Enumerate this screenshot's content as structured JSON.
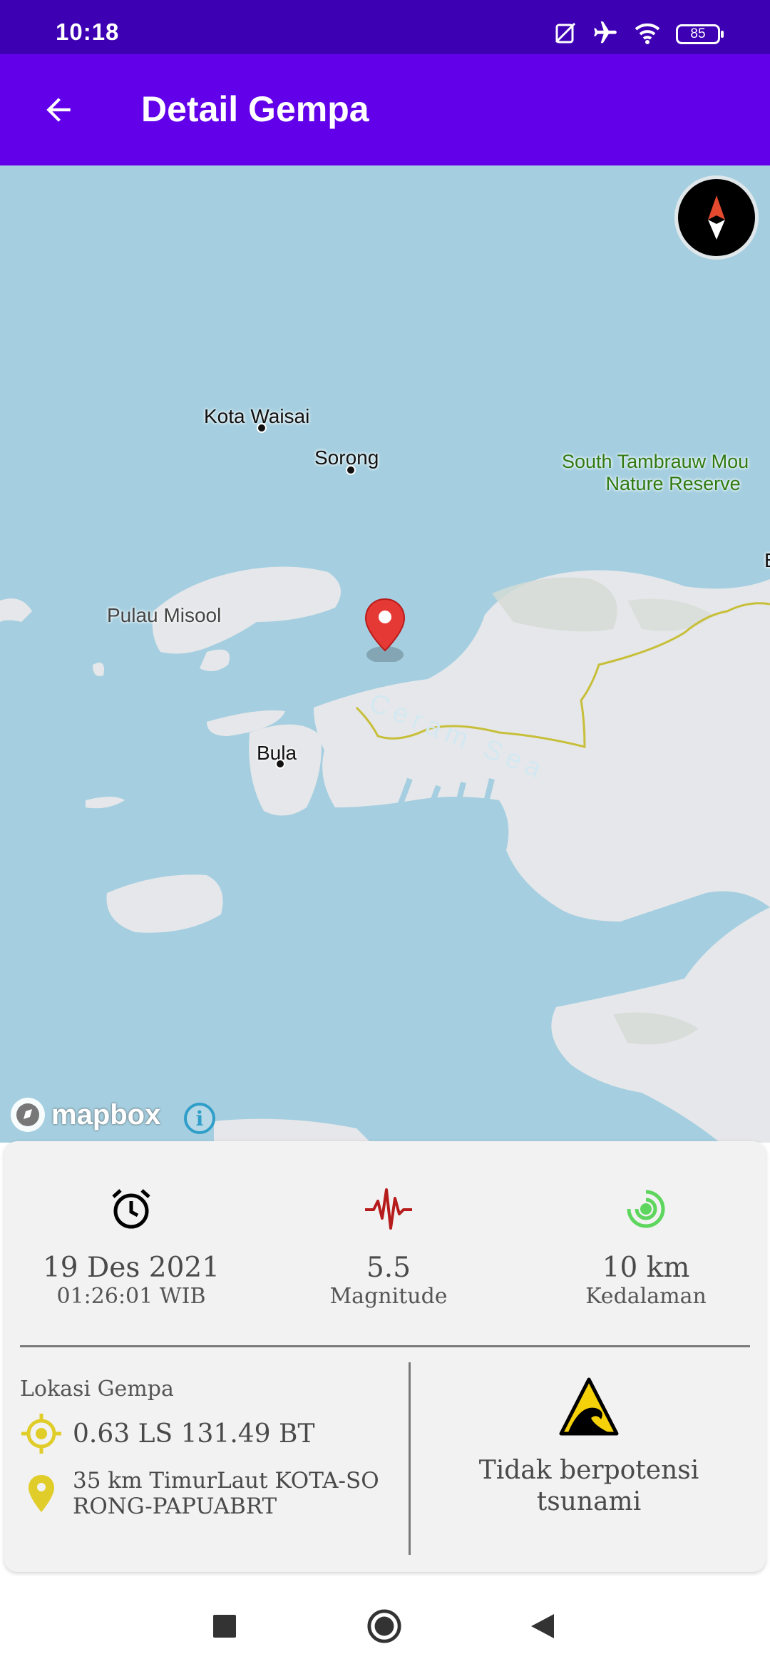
{
  "status_bar": {
    "time": "10:18",
    "battery": "85"
  },
  "app_bar": {
    "title": "Detail Gempa"
  },
  "map": {
    "labels": {
      "kota_waisai": "Kota  Waisai",
      "sorong": "Sorong",
      "park_line1": "South Tambrauw Mou",
      "park_line2": "Nature Reserve",
      "pulau_misool": "Pulau Misool",
      "bula": "Bula",
      "ceram_sea": "Ceram Sea",
      "edge_letter": "B"
    },
    "attribution": {
      "logo_text": "mapbox",
      "info_symbol": "i"
    }
  },
  "quake": {
    "date": "19 Des 2021",
    "time": "01:26:01 WIB",
    "magnitude": "5.5",
    "magnitude_label": "Magnitude",
    "depth": "10 km",
    "depth_label": "Kedalaman",
    "location_title": "Lokasi Gempa",
    "coordinates": "0.63 LS 131.49 BT",
    "area_line1": "35 km TimurLaut KOTA-SO",
    "area_line2": "RONG-PAPUABRT",
    "tsunami_line1": "Tidak berpotensi",
    "tsunami_line2": "tsunami"
  },
  "colors": {
    "status_bar": "#3d00b3",
    "app_bar": "#6200ea",
    "magnitude_icon": "#b71c1c",
    "depth_icon": "#5ed65e",
    "location_icon": "#e0cd2a",
    "pin": "#e53935"
  }
}
